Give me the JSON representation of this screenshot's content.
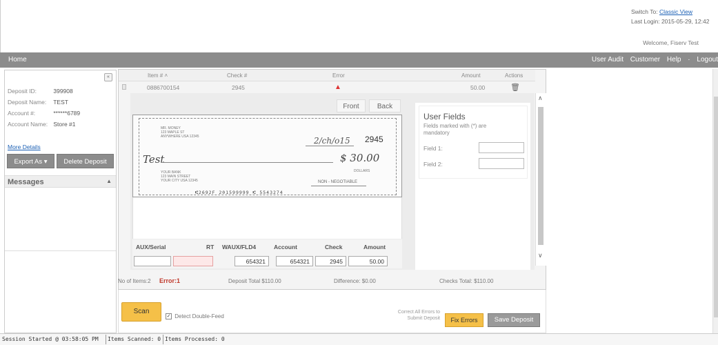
{
  "header": {
    "switch_to_label": "Switch To:",
    "classic_view_link": "Classic View",
    "last_login": "Last Login: 2015-05-29, 12:42",
    "welcome": "Welcome, Fiserv Test"
  },
  "nav": {
    "home": "Home",
    "items": [
      "User Audit",
      "Customer",
      "Help",
      "Logout"
    ],
    "separator": "·"
  },
  "deposit": {
    "collapse_icon": "«",
    "fields": [
      {
        "label": "Deposit ID:",
        "value": "399908"
      },
      {
        "label": "Deposit Name:",
        "value": "TEST"
      },
      {
        "label": "Account #:",
        "value": "******6789"
      },
      {
        "label": "Account Name:",
        "value": "Store #1"
      }
    ],
    "more_details": "More Details",
    "export_button": "Export As",
    "export_chevron": "▾",
    "delete_button": "Delete Deposit",
    "messages_title": "Messages",
    "messages_arrow": "▲"
  },
  "grid": {
    "headers": {
      "item": "Item # ˄",
      "check": "Check #",
      "error": "Error",
      "amount": "Amount",
      "actions": "Actions"
    },
    "row": {
      "item": "0886700154",
      "check": "2945",
      "error_icon": "▲",
      "amount": "50.00",
      "trash_icon": "🗑"
    }
  },
  "view": {
    "front": "Front",
    "back": "Back"
  },
  "check": {
    "number": "2945",
    "date": "2/ch/o15",
    "payee_handwritten": "Test",
    "amount_handwritten": "$ 30.00",
    "non_negotiable": "NON - NEGOTIABLE",
    "dollars_label": "DOLLARS",
    "micr": "⑆2692F 201599999 ⑆ 5543274"
  },
  "fields_table": {
    "headers": [
      "AUX/Serial",
      "RT",
      "WAUX/FLD4",
      "Account",
      "Check",
      "Amount"
    ],
    "values": [
      "",
      "",
      "654321",
      "654321",
      "2945",
      "50.00"
    ]
  },
  "user_fields": {
    "title": "User Fields",
    "note": "Fields marked with (*) are mandatory",
    "field1_label": "Field 1:",
    "field2_label": "Field 2:"
  },
  "summary": {
    "items": "No of Items:2",
    "error": "Error:1",
    "deposit_total": "Deposit Total $110.00",
    "difference": "Difference: $0.00",
    "checks_total": "Checks Total: $110.00"
  },
  "actions": {
    "scan": "Scan",
    "detect_double_feed": "Detect Double-Feed",
    "detect_checked": "✓",
    "correct_note": "Correct All Errors to Submit Deposit",
    "fix_errors": "Fix Errors",
    "save_deposit": "Save Deposit"
  },
  "status": {
    "session": "Session Started @ 03:58:05 PM",
    "scanned": "Items Scanned: 0",
    "processed": "Items Processed: 0"
  },
  "icons": {
    "scroll_up": "∧",
    "scroll_down": "∨"
  },
  "colors": {
    "nav_bg": "#8c8c8c",
    "accent_button": "#f5c048",
    "error": "#c0392b",
    "link": "#1a5fb4"
  }
}
